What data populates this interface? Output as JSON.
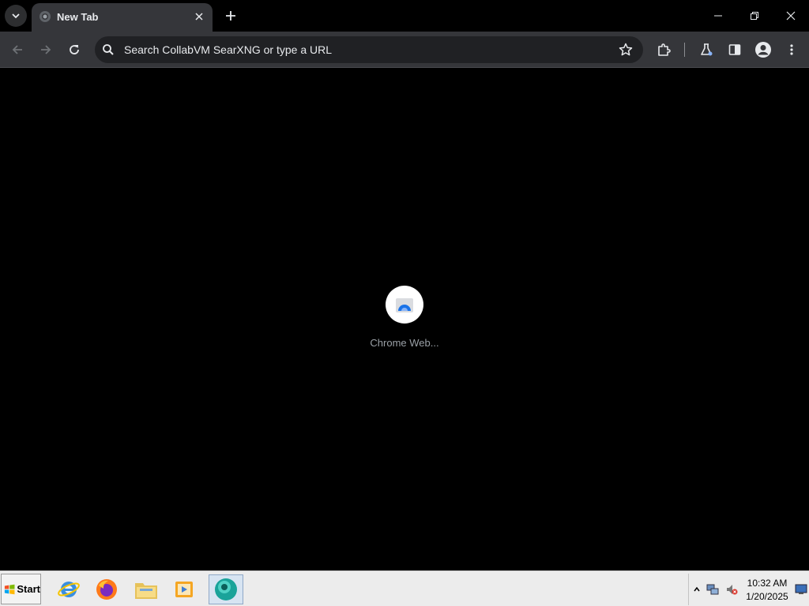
{
  "tab": {
    "title": "New Tab"
  },
  "omnibox": {
    "placeholder": "Search CollabVM SearXNG or type a URL"
  },
  "content": {
    "loading_text": "Chrome Web..."
  },
  "taskbar": {
    "start_label": "Start",
    "clock_time": "10:32 AM",
    "clock_date": "1/20/2025"
  },
  "colors": {
    "chrome_dark": "#35363a",
    "omnibox_bg": "#202124",
    "icon": "#c4c7c5",
    "taskbar_bg": "#ececec"
  }
}
